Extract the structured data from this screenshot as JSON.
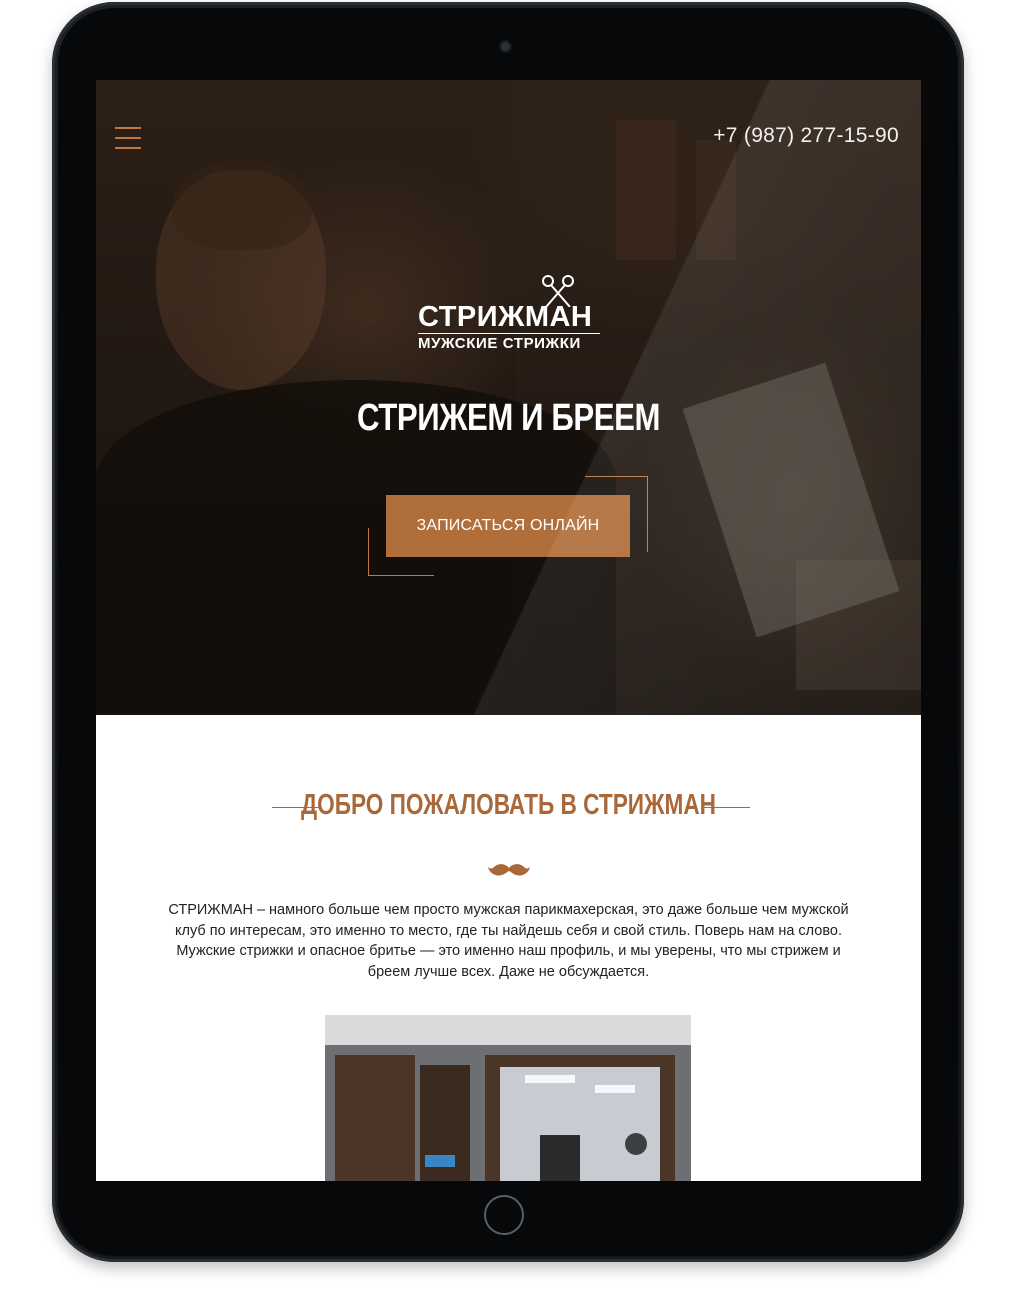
{
  "header": {
    "phone": "+7 (987) 277-15-90",
    "menu_icon": "hamburger-menu-icon"
  },
  "logo": {
    "name": "СТРИЖМАН",
    "subtitle": "МУЖСКИЕ СТРИЖКИ"
  },
  "hero": {
    "title": "СТРИЖЕМ И БРЕЕМ",
    "cta_label": "ЗАПИСАТЬСЯ ОНЛАЙН"
  },
  "welcome": {
    "title": "ДОБРО ПОЖАЛОВАТЬ В СТРИЖМАН",
    "icon": "mustache-icon",
    "description": "СТРИЖМАН – намного больше чем просто мужская парикмахерская, это даже больше чем мужской клуб по интересам, это именно то место, где ты найдешь себя и свой стиль. Поверь нам на слово. Мужские стрижки и опасное бритье — это именно наш профиль, и мы уверены, что мы стрижем и бреем лучше всех. Даже не обсуждается."
  },
  "colors": {
    "accent": "#b06e3a",
    "accent_text": "#a9683a",
    "hero_text": "#ffffff",
    "device_frame": "#0d0f11"
  }
}
